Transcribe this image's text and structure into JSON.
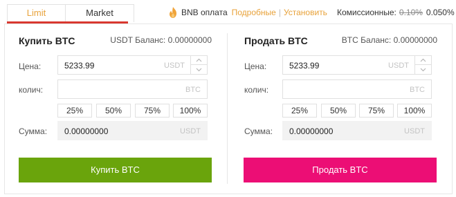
{
  "tabs": {
    "limit": "Limit",
    "market": "Market"
  },
  "bnb": {
    "label": "BNB оплата",
    "details": "Подробные",
    "separator": "|",
    "install": "Установить"
  },
  "fee": {
    "label": "Комиссионные:",
    "old": "0.10%",
    "new": "0.050%"
  },
  "buy": {
    "title": "Купить BTC",
    "balance": "USDT Баланс: 0.00000000",
    "price_label": "Цена:",
    "price_value": "5233.99",
    "price_unit": "USDT",
    "amount_label": "колич:",
    "amount_value": "",
    "amount_unit": "BTC",
    "percents": [
      "25%",
      "50%",
      "75%",
      "100%"
    ],
    "total_label": "Сумма:",
    "total_value": "0.00000000",
    "total_unit": "USDT",
    "button": "Купить BTC"
  },
  "sell": {
    "title": "Продать BTC",
    "balance": "BTC Баланс: 0.00000000",
    "price_label": "Цена:",
    "price_value": "5233.99",
    "price_unit": "USDT",
    "amount_label": "колич:",
    "amount_value": "",
    "amount_unit": "BTC",
    "percents": [
      "25%",
      "50%",
      "75%",
      "100%"
    ],
    "total_label": "Сумма:",
    "total_value": "0.00000000",
    "total_unit": "USDT",
    "button": "Продать BTC"
  },
  "colors": {
    "accent": "#e8a23a",
    "tab_underline": "#d9382f",
    "buy": "#6aa40c",
    "sell": "#ec0e75"
  },
  "icons": {
    "bnb": "flame-icon",
    "step_up": "chevron-up-icon",
    "step_down": "chevron-down-icon"
  }
}
